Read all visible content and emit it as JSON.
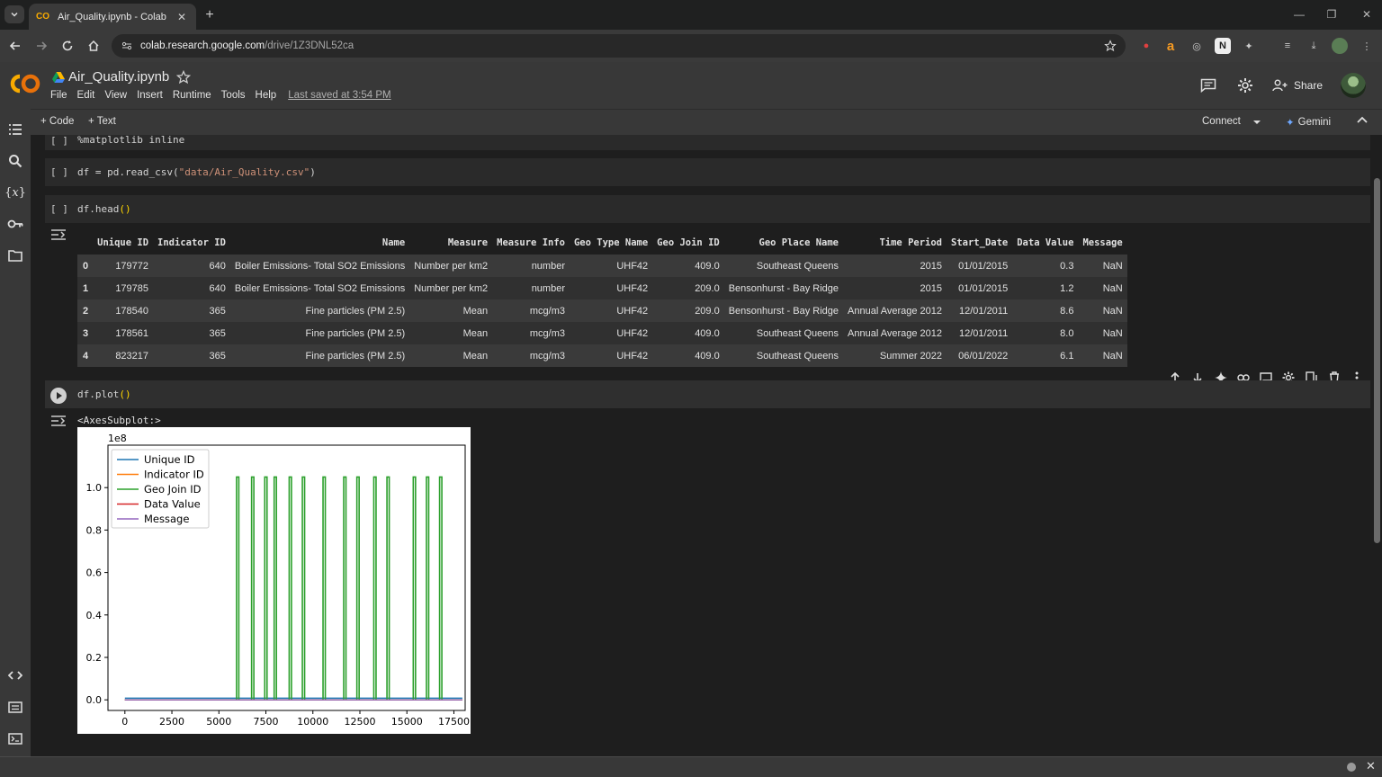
{
  "browser": {
    "tab_title": "Air_Quality.ipynb - Colab",
    "url_host": "colab.research.google.com",
    "url_path": "/drive/1Z3DNL52ca"
  },
  "colab": {
    "notebook_title": "Air_Quality.ipynb",
    "menu": [
      "File",
      "Edit",
      "View",
      "Insert",
      "Runtime",
      "Tools",
      "Help"
    ],
    "last_saved": "Last saved at 3:54 PM",
    "share_label": "Share",
    "add_code_label": "+ Code",
    "add_text_label": "+ Text",
    "connect_label": "Connect",
    "gemini_label": "Gemini"
  },
  "cells": {
    "partial_code": "%matplotlib inline",
    "read_csv_prefix": "df = pd.read_csv(",
    "read_csv_arg": "\"data/Air_Quality.csv\"",
    "read_csv_suffix": ")",
    "head_code": "df.head",
    "head_parens": "()",
    "plot_code": "df.plot",
    "plot_parens": "()",
    "bracket": "[ ]",
    "axes_repr": "<AxesSubplot:>"
  },
  "table": {
    "columns": [
      "",
      "Unique ID",
      "Indicator ID",
      "Name",
      "Measure",
      "Measure Info",
      "Geo Type Name",
      "Geo Join ID",
      "Geo Place Name",
      "Time Period",
      "Start_Date",
      "Data Value",
      "Message"
    ],
    "rows": [
      [
        "0",
        "179772",
        "640",
        "Boiler Emissions- Total SO2 Emissions",
        "Number per km2",
        "number",
        "UHF42",
        "409.0",
        "Southeast Queens",
        "2015",
        "01/01/2015",
        "0.3",
        "NaN"
      ],
      [
        "1",
        "179785",
        "640",
        "Boiler Emissions- Total SO2 Emissions",
        "Number per km2",
        "number",
        "UHF42",
        "209.0",
        "Bensonhurst - Bay Ridge",
        "2015",
        "01/01/2015",
        "1.2",
        "NaN"
      ],
      [
        "2",
        "178540",
        "365",
        "Fine particles (PM 2.5)",
        "Mean",
        "mcg/m3",
        "UHF42",
        "209.0",
        "Bensonhurst - Bay Ridge",
        "Annual Average 2012",
        "12/01/2011",
        "8.6",
        "NaN"
      ],
      [
        "3",
        "178561",
        "365",
        "Fine particles (PM 2.5)",
        "Mean",
        "mcg/m3",
        "UHF42",
        "409.0",
        "Southeast Queens",
        "Annual Average 2012",
        "12/01/2011",
        "8.0",
        "NaN"
      ],
      [
        "4",
        "823217",
        "365",
        "Fine particles (PM 2.5)",
        "Mean",
        "mcg/m3",
        "UHF42",
        "409.0",
        "Southeast Queens",
        "Summer 2022",
        "06/01/2022",
        "6.1",
        "NaN"
      ]
    ]
  },
  "chart_data": {
    "type": "line",
    "title": "",
    "xlabel": "",
    "ylabel": "",
    "offset_text": "1e8",
    "xlim": [
      -900,
      18100
    ],
    "ylim": [
      -0.05,
      1.2
    ],
    "x_ticks": [
      0,
      2500,
      5000,
      7500,
      10000,
      12500,
      15000,
      17500
    ],
    "x_tick_labels": [
      "0",
      "2500",
      "5000",
      "7500",
      "10000",
      "12500",
      "15000",
      "17500"
    ],
    "y_ticks": [
      0.0,
      0.2,
      0.4,
      0.6,
      0.8,
      1.0
    ],
    "y_tick_labels": [
      "0.0",
      "0.2",
      "0.4",
      "0.6",
      "0.8",
      "1.0"
    ],
    "legend_position": "upper-left",
    "series": [
      {
        "name": "Unique ID",
        "color": "#1f77b4",
        "baseline": 0.008
      },
      {
        "name": "Indicator ID",
        "color": "#ff7f0e",
        "baseline": 0.0
      },
      {
        "name": "Geo Join ID",
        "color": "#2ca02c",
        "baseline": 0.0,
        "spike_x": [
          6000,
          6800,
          7500,
          8000,
          8800,
          9500,
          10600,
          11700,
          12400,
          13300,
          14000,
          15400,
          16100,
          16800
        ],
        "spike_y": 1.05
      },
      {
        "name": "Data Value",
        "color": "#d62728",
        "baseline": 0.0
      },
      {
        "name": "Message",
        "color": "#9467bd",
        "baseline": 0.0
      }
    ]
  }
}
